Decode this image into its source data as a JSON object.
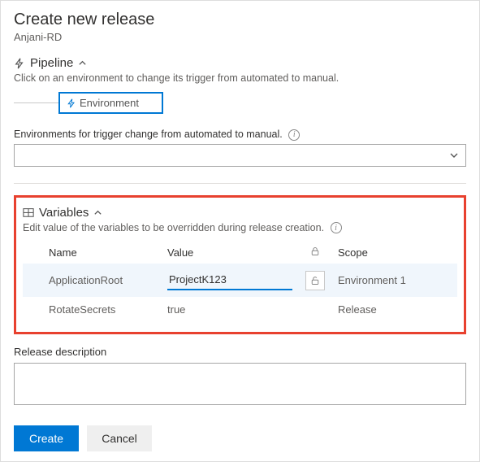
{
  "header": {
    "title": "Create new release",
    "subtitle": "Anjani-RD"
  },
  "pipeline": {
    "label": "Pipeline",
    "hint": "Click on an environment to change its trigger from automated to manual.",
    "stage_label": "Environment"
  },
  "environments": {
    "label": "Environments for trigger change from automated to manual.",
    "selected": ""
  },
  "variables": {
    "label": "Variables",
    "hint": "Edit value of the variables to be overridden during release creation.",
    "columns": {
      "name": "Name",
      "value": "Value",
      "scope": "Scope"
    },
    "rows": [
      {
        "name": "ApplicationRoot",
        "value": "ProjectK123",
        "scope": "Environment 1",
        "editing": true
      },
      {
        "name": "RotateSecrets",
        "value": "true",
        "scope": "Release",
        "editing": false
      }
    ]
  },
  "description": {
    "label": "Release description",
    "value": ""
  },
  "buttons": {
    "create": "Create",
    "cancel": "Cancel"
  }
}
